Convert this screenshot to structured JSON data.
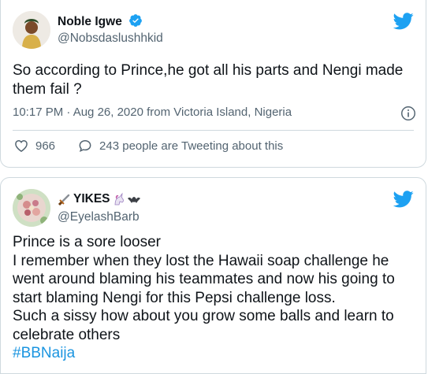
{
  "tweets": [
    {
      "name": "Noble Igwe",
      "handle": "@Nobsdaslushhkid",
      "verified": true,
      "text": "So according to Prince,he got all his parts and Nengi made them fail ?",
      "meta": "10:17 PM · Aug 26, 2020 from Victoria Island, Nigeria",
      "like_count": "966",
      "reply_text": "243 people are Tweeting about this"
    },
    {
      "name": "YIKES",
      "handle": "@EyelashBarb",
      "name_icons": [
        "dagger-icon",
        "unicorn-icon",
        "bat-icon"
      ],
      "text": "Prince is a sore looser\nI remember when they lost the Hawaii soap challenge he went around blaming his teammates and now his going to start blaming Nengi for this Pepsi challenge loss.\nSuch a sissy how about you grow some balls and learn to celebrate others",
      "hashtag": "#BBNaija"
    }
  ],
  "colors": {
    "twitter_blue": "#1da1f2",
    "link_blue": "#1b95e0",
    "text": "#0f1419",
    "muted": "#536471",
    "border": "#cfd9de"
  }
}
